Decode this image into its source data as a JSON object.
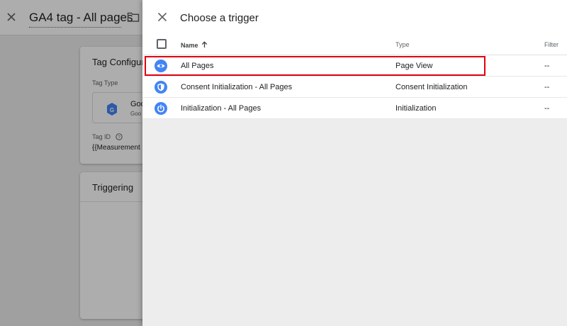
{
  "background": {
    "tag_title": "GA4 tag - All pages",
    "config_card": {
      "title": "Tag Configura",
      "tag_type_label": "Tag Type",
      "tag_type_name": "Goo",
      "tag_type_sub": "Goo",
      "tag_type_icon": "google-tag-icon",
      "tag_id_label": "Tag ID",
      "tag_id_value": "{{Measurement"
    },
    "triggering_card": {
      "title": "Triggering"
    }
  },
  "panel": {
    "title": "Choose a trigger",
    "columns": {
      "name": "Name",
      "type": "Type",
      "filter": "Filter"
    },
    "rows": [
      {
        "name": "All Pages",
        "type": "Page View",
        "filter": "--",
        "icon": "eye-icon",
        "highlighted": true
      },
      {
        "name": "Consent Initialization - All Pages",
        "type": "Consent Initialization",
        "filter": "--",
        "icon": "shield-icon",
        "highlighted": false
      },
      {
        "name": "Initialization - All Pages",
        "type": "Initialization",
        "filter": "--",
        "icon": "power-icon",
        "highlighted": false
      }
    ]
  },
  "colors": {
    "icon_blue": "#4285f4",
    "highlight_red": "#e1000f",
    "panel_bg": "#ededed"
  }
}
